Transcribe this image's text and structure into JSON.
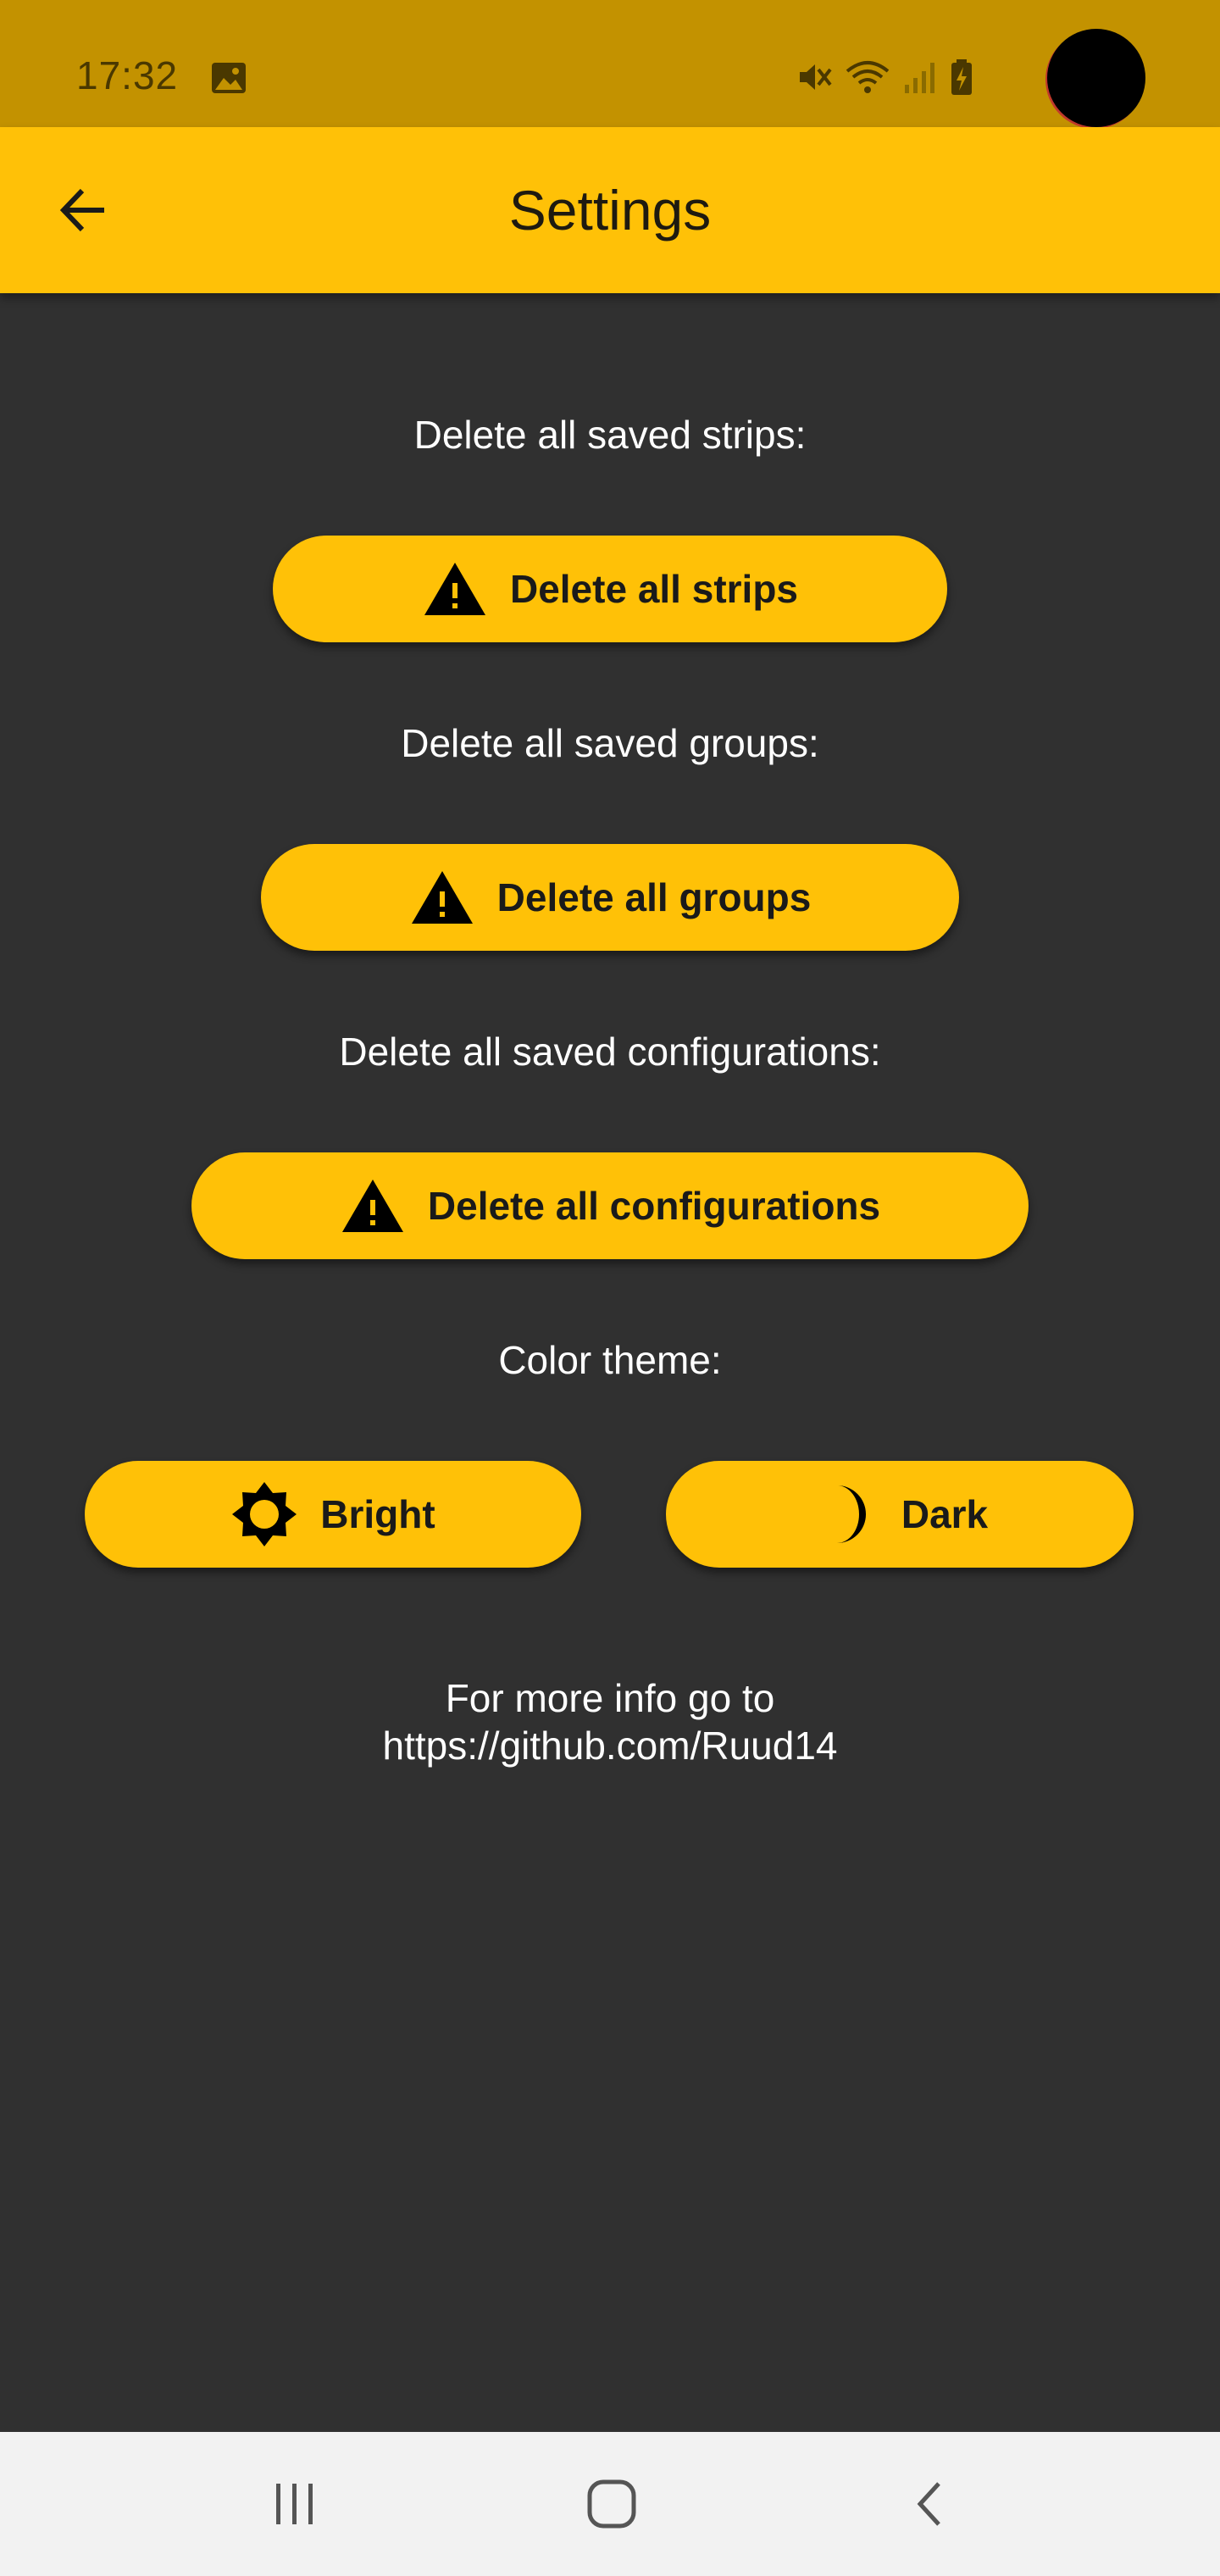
{
  "status_bar": {
    "time": "17:32",
    "icons": [
      "gallery-icon",
      "mute-icon",
      "wifi-icon",
      "signal-icon",
      "battery-charging-icon"
    ]
  },
  "app_bar": {
    "title": "Settings",
    "back_icon": "arrow-back-icon"
  },
  "settings": {
    "strips": {
      "label": "Delete all saved strips:",
      "button": "Delete all strips",
      "icon": "warning-icon"
    },
    "groups": {
      "label": "Delete all saved groups:",
      "button": "Delete all groups",
      "icon": "warning-icon"
    },
    "configurations": {
      "label": "Delete all saved configurations:",
      "button": "Delete all configurations",
      "icon": "warning-icon"
    },
    "theme": {
      "label": "Color theme:",
      "bright": {
        "label": "Bright",
        "icon": "sun-icon"
      },
      "dark": {
        "label": "Dark",
        "icon": "moon-icon"
      }
    },
    "info": {
      "line1": "For more info go to",
      "line2": "https://github.com/Ruud14"
    }
  },
  "nav_bar": {
    "buttons": [
      "recent-apps-icon",
      "home-icon",
      "back-icon"
    ]
  },
  "colors": {
    "status_bar": "#C39200",
    "accent": "#FFC107",
    "background": "#303030",
    "nav_bar": "#F2F2F2"
  }
}
